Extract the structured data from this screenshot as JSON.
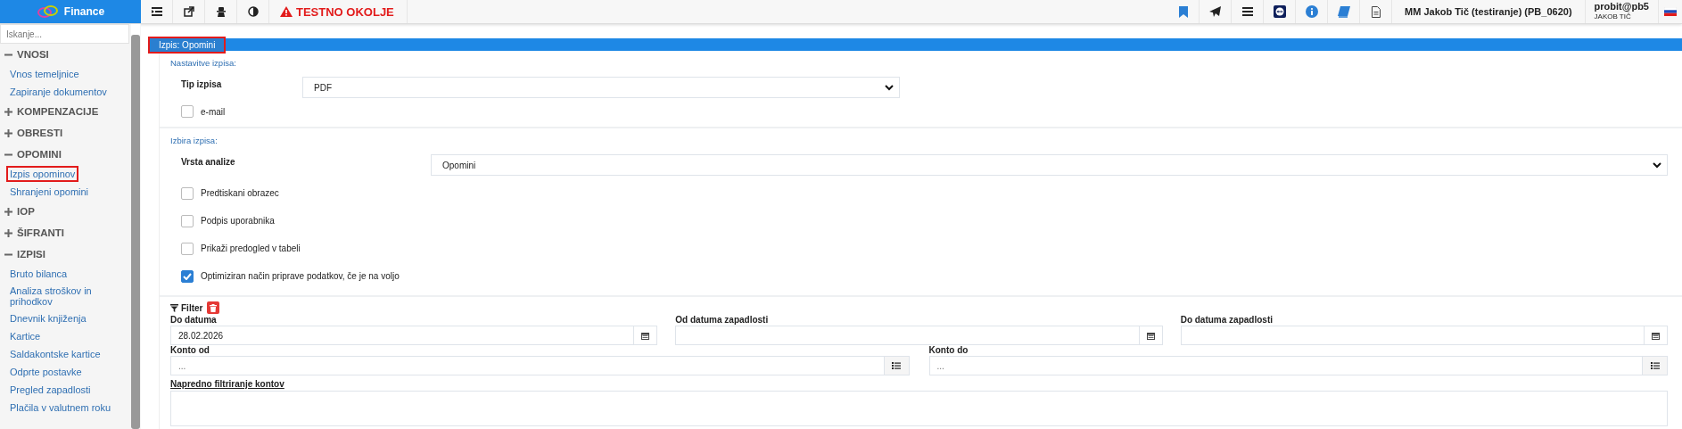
{
  "app": {
    "name": "Finance"
  },
  "toolbar": {
    "warning": "TESTNO OKOLJE",
    "company": "MM Jakob Tič (testiranje) (PB_0620)",
    "account": "probit@pb5",
    "user": "JAKOB TIČ"
  },
  "sidebar": {
    "search_placeholder": "Iskanje...",
    "groups": [
      {
        "label": "VNOSI",
        "expanded": true,
        "children": [
          {
            "label": "Vnos temeljnice",
            "selected": false
          },
          {
            "label": "Zapiranje dokumentov",
            "selected": false
          }
        ]
      },
      {
        "label": "KOMPENZACIJE",
        "expanded": false
      },
      {
        "label": "OBRESTI",
        "expanded": false
      },
      {
        "label": "OPOMINI",
        "expanded": true,
        "children": [
          {
            "label": "Izpis opominov",
            "selected": true
          },
          {
            "label": "Shranjeni opomini",
            "selected": false
          }
        ]
      },
      {
        "label": "IOP",
        "expanded": false
      },
      {
        "label": "ŠIFRANTI",
        "expanded": false
      },
      {
        "label": "IZPISI",
        "expanded": true,
        "children": [
          {
            "label": "Bruto bilanca",
            "selected": false
          },
          {
            "label": "Analiza stroškov in prihodkov",
            "selected": false
          },
          {
            "label": "Dnevnik knjiženja",
            "selected": false
          },
          {
            "label": "Kartice",
            "selected": false
          },
          {
            "label": "Saldakontske kartice",
            "selected": false
          },
          {
            "label": "Odprte postavke",
            "selected": false
          },
          {
            "label": "Pregled zapadlosti",
            "selected": false
          },
          {
            "label": "Plačila v valutnem roku",
            "selected": false
          }
        ]
      }
    ]
  },
  "panel": {
    "title": "Izpis: Opomini",
    "selected": true
  },
  "settings": {
    "heading": "Nastavitve izpisa:",
    "type_label": "Tip izpisa",
    "type_value": "PDF",
    "email": {
      "label": "e-mail",
      "checked": false
    }
  },
  "selection": {
    "heading": "Izbira izpisa:",
    "analysis_label": "Vrsta analize",
    "analysis_value": "Opomini",
    "options": [
      {
        "label": "Predtiskani obrazec",
        "checked": false
      },
      {
        "label": "Podpis uporabnika",
        "checked": false
      },
      {
        "label": "Prikaži predogled v tabeli",
        "checked": false
      },
      {
        "label": "Optimiziran način priprave podatkov, če je na voljo",
        "checked": true
      }
    ]
  },
  "filter": {
    "title": "Filter",
    "date_fields": [
      {
        "label": "Do datuma",
        "value": "28.02.2026"
      },
      {
        "label": "Od datuma zapadlosti"
      },
      {
        "label": "Do datuma zapadlosti"
      }
    ],
    "account_fields": [
      {
        "label": "Konto od",
        "placeholder": "..."
      },
      {
        "label": "Konto do",
        "placeholder": "..."
      }
    ],
    "advanced_label": "Napredno filtriranje kontov"
  }
}
